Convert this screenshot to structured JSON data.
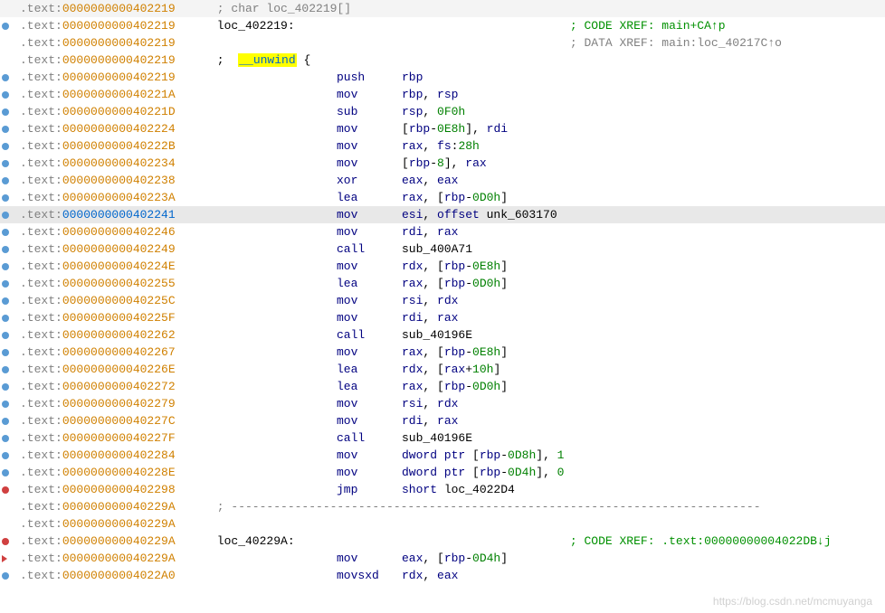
{
  "watermark": "https://blog.csdn.net/mcmuyanga",
  "lines": [
    {
      "dot": "",
      "section": ".text:",
      "addr": "0000000000402219",
      "addr_cls": "addr",
      "rest": " ; char loc_402219[]",
      "rest_cls": "section",
      "bg": "bg-top-gray"
    },
    {
      "dot": "blue",
      "section": ".text:",
      "addr": "0000000000402219",
      "label": "loc_402219:",
      "xref": "; CODE XREF: main+CA",
      "xref_arrow": "↑p",
      "xref_type": "code"
    },
    {
      "dot": "",
      "section": ".text:",
      "addr": "0000000000402219",
      "xref": "; DATA XREF: main:loc_40217C",
      "xref_arrow": "↑o",
      "xref_type": "data"
    },
    {
      "dot": "",
      "section": ".text:",
      "addr": "0000000000402219",
      "unwind": " ;  ",
      "hl": "__unwind",
      "after_hl": " {"
    },
    {
      "dot": "blue",
      "section": ".text:",
      "addr": "0000000000402219",
      "mnem": "push",
      "ops": [
        {
          "t": "rbp",
          "c": "reg"
        }
      ]
    },
    {
      "dot": "blue",
      "section": ".text:",
      "addr": "000000000040221A",
      "mnem": "mov",
      "ops": [
        {
          "t": "rbp",
          "c": "reg"
        },
        {
          "t": ", ",
          "c": "text-black"
        },
        {
          "t": "rsp",
          "c": "reg"
        }
      ]
    },
    {
      "dot": "blue",
      "section": ".text:",
      "addr": "000000000040221D",
      "mnem": "sub",
      "ops": [
        {
          "t": "rsp",
          "c": "reg"
        },
        {
          "t": ", ",
          "c": "text-black"
        },
        {
          "t": "0F0h",
          "c": "number"
        }
      ]
    },
    {
      "dot": "blue",
      "section": ".text:",
      "addr": "0000000000402224",
      "mnem": "mov",
      "ops": [
        {
          "t": "[",
          "c": "bracket"
        },
        {
          "t": "rbp",
          "c": "reg"
        },
        {
          "t": "-",
          "c": "text-black"
        },
        {
          "t": "0E8h",
          "c": "number"
        },
        {
          "t": "]",
          "c": "bracket"
        },
        {
          "t": ", ",
          "c": "text-black"
        },
        {
          "t": "rdi",
          "c": "reg"
        }
      ]
    },
    {
      "dot": "blue",
      "section": ".text:",
      "addr": "000000000040222B",
      "mnem": "mov",
      "ops": [
        {
          "t": "rax",
          "c": "reg"
        },
        {
          "t": ", ",
          "c": "text-black"
        },
        {
          "t": "fs",
          "c": "reg"
        },
        {
          "t": ":",
          "c": "text-black"
        },
        {
          "t": "28h",
          "c": "number"
        }
      ]
    },
    {
      "dot": "blue",
      "section": ".text:",
      "addr": "0000000000402234",
      "mnem": "mov",
      "ops": [
        {
          "t": "[",
          "c": "bracket"
        },
        {
          "t": "rbp",
          "c": "reg"
        },
        {
          "t": "-",
          "c": "text-black"
        },
        {
          "t": "8",
          "c": "number"
        },
        {
          "t": "]",
          "c": "bracket"
        },
        {
          "t": ", ",
          "c": "text-black"
        },
        {
          "t": "rax",
          "c": "reg"
        }
      ]
    },
    {
      "dot": "blue",
      "section": ".text:",
      "addr": "0000000000402238",
      "mnem": "xor",
      "ops": [
        {
          "t": "eax",
          "c": "reg"
        },
        {
          "t": ", ",
          "c": "text-black"
        },
        {
          "t": "eax",
          "c": "reg"
        }
      ]
    },
    {
      "dot": "blue",
      "section": ".text:",
      "addr": "000000000040223A",
      "mnem": "lea",
      "ops": [
        {
          "t": "rax",
          "c": "reg"
        },
        {
          "t": ", [",
          "c": "text-black"
        },
        {
          "t": "rbp",
          "c": "reg"
        },
        {
          "t": "-",
          "c": "text-black"
        },
        {
          "t": "0D0h",
          "c": "number"
        },
        {
          "t": "]",
          "c": "bracket"
        }
      ]
    },
    {
      "dot": "blue",
      "section": ".text:",
      "addr": "0000000000402241",
      "mnem": "mov",
      "ops": [
        {
          "t": "esi",
          "c": "reg"
        },
        {
          "t": ", ",
          "c": "text-black"
        },
        {
          "t": "offset",
          "c": "keyword"
        },
        {
          "t": " unk_603170",
          "c": "text-black"
        }
      ],
      "selected": true
    },
    {
      "dot": "blue",
      "section": ".text:",
      "addr": "0000000000402246",
      "mnem": "mov",
      "ops": [
        {
          "t": "rdi",
          "c": "reg"
        },
        {
          "t": ", ",
          "c": "text-black"
        },
        {
          "t": "rax",
          "c": "reg"
        }
      ]
    },
    {
      "dot": "blue",
      "section": ".text:",
      "addr": "0000000000402249",
      "mnem": "call",
      "ops": [
        {
          "t": "sub_400A71",
          "c": "text-black"
        }
      ]
    },
    {
      "dot": "blue",
      "section": ".text:",
      "addr": "000000000040224E",
      "mnem": "mov",
      "ops": [
        {
          "t": "rdx",
          "c": "reg"
        },
        {
          "t": ", [",
          "c": "text-black"
        },
        {
          "t": "rbp",
          "c": "reg"
        },
        {
          "t": "-",
          "c": "text-black"
        },
        {
          "t": "0E8h",
          "c": "number"
        },
        {
          "t": "]",
          "c": "bracket"
        }
      ]
    },
    {
      "dot": "blue",
      "section": ".text:",
      "addr": "0000000000402255",
      "mnem": "lea",
      "ops": [
        {
          "t": "rax",
          "c": "reg"
        },
        {
          "t": ", [",
          "c": "text-black"
        },
        {
          "t": "rbp",
          "c": "reg"
        },
        {
          "t": "-",
          "c": "text-black"
        },
        {
          "t": "0D0h",
          "c": "number"
        },
        {
          "t": "]",
          "c": "bracket"
        }
      ]
    },
    {
      "dot": "blue",
      "section": ".text:",
      "addr": "000000000040225C",
      "mnem": "mov",
      "ops": [
        {
          "t": "rsi",
          "c": "reg"
        },
        {
          "t": ", ",
          "c": "text-black"
        },
        {
          "t": "rdx",
          "c": "reg"
        }
      ]
    },
    {
      "dot": "blue",
      "section": ".text:",
      "addr": "000000000040225F",
      "mnem": "mov",
      "ops": [
        {
          "t": "rdi",
          "c": "reg"
        },
        {
          "t": ", ",
          "c": "text-black"
        },
        {
          "t": "rax",
          "c": "reg"
        }
      ]
    },
    {
      "dot": "blue",
      "section": ".text:",
      "addr": "0000000000402262",
      "mnem": "call",
      "ops": [
        {
          "t": "sub_40196E",
          "c": "text-black"
        }
      ]
    },
    {
      "dot": "blue",
      "section": ".text:",
      "addr": "0000000000402267",
      "mnem": "mov",
      "ops": [
        {
          "t": "rax",
          "c": "reg"
        },
        {
          "t": ", [",
          "c": "text-black"
        },
        {
          "t": "rbp",
          "c": "reg"
        },
        {
          "t": "-",
          "c": "text-black"
        },
        {
          "t": "0E8h",
          "c": "number"
        },
        {
          "t": "]",
          "c": "bracket"
        }
      ]
    },
    {
      "dot": "blue",
      "section": ".text:",
      "addr": "000000000040226E",
      "mnem": "lea",
      "ops": [
        {
          "t": "rdx",
          "c": "reg"
        },
        {
          "t": ", [",
          "c": "text-black"
        },
        {
          "t": "rax",
          "c": "reg"
        },
        {
          "t": "+",
          "c": "text-black"
        },
        {
          "t": "10h",
          "c": "number"
        },
        {
          "t": "]",
          "c": "bracket"
        }
      ]
    },
    {
      "dot": "blue",
      "section": ".text:",
      "addr": "0000000000402272",
      "mnem": "lea",
      "ops": [
        {
          "t": "rax",
          "c": "reg"
        },
        {
          "t": ", [",
          "c": "text-black"
        },
        {
          "t": "rbp",
          "c": "reg"
        },
        {
          "t": "-",
          "c": "text-black"
        },
        {
          "t": "0D0h",
          "c": "number"
        },
        {
          "t": "]",
          "c": "bracket"
        }
      ]
    },
    {
      "dot": "blue",
      "section": ".text:",
      "addr": "0000000000402279",
      "mnem": "mov",
      "ops": [
        {
          "t": "rsi",
          "c": "reg"
        },
        {
          "t": ", ",
          "c": "text-black"
        },
        {
          "t": "rdx",
          "c": "reg"
        }
      ]
    },
    {
      "dot": "blue",
      "section": ".text:",
      "addr": "000000000040227C",
      "mnem": "mov",
      "ops": [
        {
          "t": "rdi",
          "c": "reg"
        },
        {
          "t": ", ",
          "c": "text-black"
        },
        {
          "t": "rax",
          "c": "reg"
        }
      ]
    },
    {
      "dot": "blue",
      "section": ".text:",
      "addr": "000000000040227F",
      "mnem": "call",
      "ops": [
        {
          "t": "sub_40196E",
          "c": "text-black"
        }
      ]
    },
    {
      "dot": "blue",
      "section": ".text:",
      "addr": "0000000000402284",
      "mnem": "mov",
      "ops": [
        {
          "t": "dword ptr",
          "c": "keyword"
        },
        {
          "t": " [",
          "c": "text-black"
        },
        {
          "t": "rbp",
          "c": "reg"
        },
        {
          "t": "-",
          "c": "text-black"
        },
        {
          "t": "0D8h",
          "c": "number"
        },
        {
          "t": "], ",
          "c": "text-black"
        },
        {
          "t": "1",
          "c": "number"
        }
      ]
    },
    {
      "dot": "blue",
      "section": ".text:",
      "addr": "000000000040228E",
      "mnem": "mov",
      "ops": [
        {
          "t": "dword ptr",
          "c": "keyword"
        },
        {
          "t": " [",
          "c": "text-black"
        },
        {
          "t": "rbp",
          "c": "reg"
        },
        {
          "t": "-",
          "c": "text-black"
        },
        {
          "t": "0D4h",
          "c": "number"
        },
        {
          "t": "], ",
          "c": "text-black"
        },
        {
          "t": "0",
          "c": "number"
        }
      ]
    },
    {
      "dot": "red",
      "section": ".text:",
      "addr": "0000000000402298",
      "mnem": "jmp",
      "ops": [
        {
          "t": "short",
          "c": "keyword"
        },
        {
          "t": " loc_4022D4",
          "c": "text-black"
        }
      ]
    },
    {
      "dot": "",
      "section": ".text:",
      "addr": "000000000040229A",
      "dash": " ; ---------------------------------------------------------------------------"
    },
    {
      "dot": "",
      "section": ".text:",
      "addr": "000000000040229A"
    },
    {
      "dot": "red",
      "section": ".text:",
      "addr": "000000000040229A",
      "label": "loc_40229A:",
      "xref": "; CODE XREF: .text:00000000004022DB",
      "xref_arrow": "↓j",
      "xref_type": "code"
    },
    {
      "dot": "arrow",
      "section": ".text:",
      "addr": "000000000040229A",
      "mnem": "mov",
      "ops": [
        {
          "t": "eax",
          "c": "reg"
        },
        {
          "t": ", [",
          "c": "text-black"
        },
        {
          "t": "rbp",
          "c": "reg"
        },
        {
          "t": "-",
          "c": "text-black"
        },
        {
          "t": "0D4h",
          "c": "number"
        },
        {
          "t": "]",
          "c": "bracket"
        }
      ]
    },
    {
      "dot": "blue",
      "section": ".text:",
      "addr": "00000000004022A0",
      "mnem": "movsxd",
      "ops": [
        {
          "t": "rdx",
          "c": "reg"
        },
        {
          "t": ", ",
          "c": "text-black"
        },
        {
          "t": "eax",
          "c": "reg"
        }
      ]
    }
  ]
}
